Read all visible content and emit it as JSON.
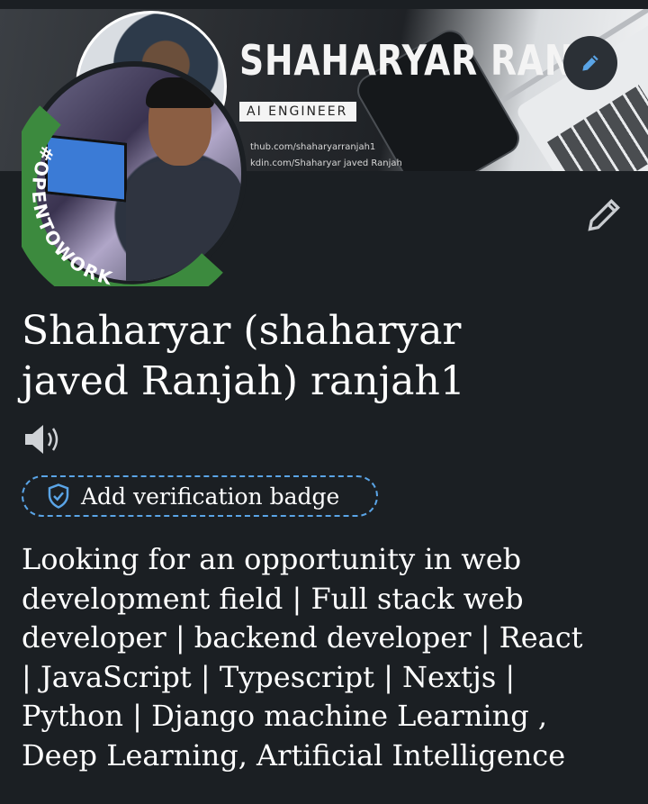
{
  "banner": {
    "name": "SHAHARYAR RANJA",
    "title": "AI ENGINEER",
    "link1": "thub.com/shaharyarranjah1",
    "link2": "kdin.com/Shaharyar javed Ranjah"
  },
  "avatar": {
    "frame_text": "#OPENTOWORK",
    "frame_color": "#3c8a3e"
  },
  "profile": {
    "name_line1": "Shaharyar (shaharyar",
    "name_line2": "javed Ranjah) ranjah1",
    "verification_label": "Add verification badge",
    "headline": "Looking for an opportunity in web\ndevelopment field | Full stack web\ndeveloper | backend developer | React\n| JavaScript | Typescript | Nextjs |\nPython | Django  machine Learning ,\nDeep Learning, Artificial Intelligence"
  },
  "icons": {
    "edit_banner": "pencil-icon",
    "edit_profile": "pencil-icon",
    "pronunciation": "speaker-icon",
    "verify": "shield-check-icon"
  },
  "colors": {
    "background": "#1b1f23",
    "accent_blue": "#5aa4e6",
    "open_to_work_green": "#3c8a3e"
  }
}
